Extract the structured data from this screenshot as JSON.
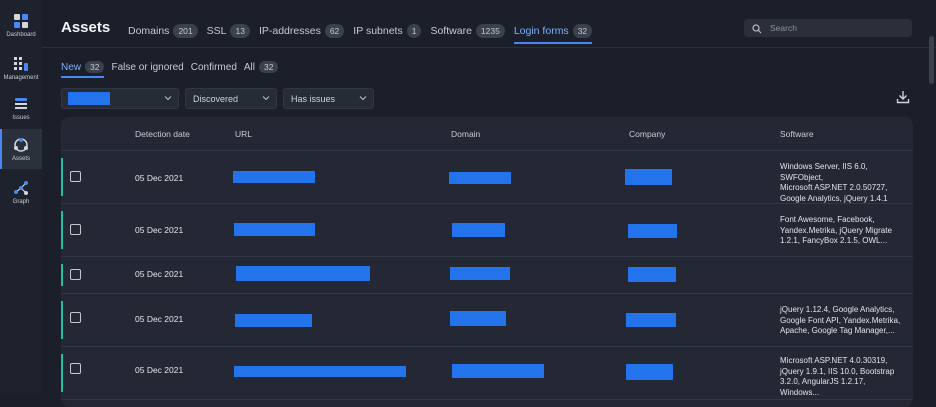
{
  "sidebar": {
    "items": [
      {
        "label": "Dashboard",
        "icon": "dashboard-icon"
      },
      {
        "label": "Management",
        "icon": "management-icon"
      },
      {
        "label": "Issues",
        "icon": "issues-icon"
      },
      {
        "label": "Assets",
        "icon": "assets-icon",
        "active": true
      },
      {
        "label": "Graph",
        "icon": "graph-icon"
      }
    ]
  },
  "header": {
    "title": "Assets",
    "tabs": [
      {
        "label": "Domains",
        "count": "201"
      },
      {
        "label": "SSL",
        "count": "13"
      },
      {
        "label": "IP-addresses",
        "count": "62"
      },
      {
        "label": "IP subnets",
        "count": "1"
      },
      {
        "label": "Software",
        "count": "1235"
      },
      {
        "label": "Login forms",
        "count": "32",
        "active": true
      }
    ],
    "search_placeholder": "Search"
  },
  "subtabs": [
    {
      "label": "New",
      "count": "32",
      "active": true
    },
    {
      "label": "False or ignored",
      "count": ""
    },
    {
      "label": "Confirmed",
      "count": ""
    },
    {
      "label": "All",
      "count": "32"
    }
  ],
  "filters": {
    "status": "Discovered",
    "issues": "Has issues"
  },
  "table": {
    "columns": [
      "Detection date",
      "URL",
      "Domain",
      "Company",
      "Software"
    ],
    "rows": [
      {
        "date": "05 Dec 2021",
        "software": [
          "Windows Server, IIS 6.0, SWFObject,",
          "Microsoft ASP.NET 2.0.50727,",
          "Google Analytics, jQuery 1.4.1"
        ]
      },
      {
        "date": "05 Dec 2021",
        "software": [
          "Font Awesome, Facebook,",
          "Yandex.Metrika, jQuery Migrate",
          "1.2.1, FancyBox 2.1.5, OWL..."
        ]
      },
      {
        "date": "05 Dec 2021",
        "software": []
      },
      {
        "date": "05 Dec 2021",
        "software": [
          "jQuery 1.12.4, Google Analytics,",
          "Google Font API, Yandex.Metrika,",
          "Apache, Google Tag Manager,..."
        ]
      },
      {
        "date": "05 Dec 2021",
        "software": [
          "Microsoft ASP.NET 4.0.30319,",
          "jQuery 1.9.1, IIS 10.0, Bootstrap",
          "3.2.0, AngularJS 1.2.17, Windows..."
        ]
      }
    ]
  },
  "colors": {
    "accent": "#4b86f5",
    "redaction": "#2273ec",
    "row_marker": "#1fbfa3",
    "background": "#1b1f2a"
  }
}
